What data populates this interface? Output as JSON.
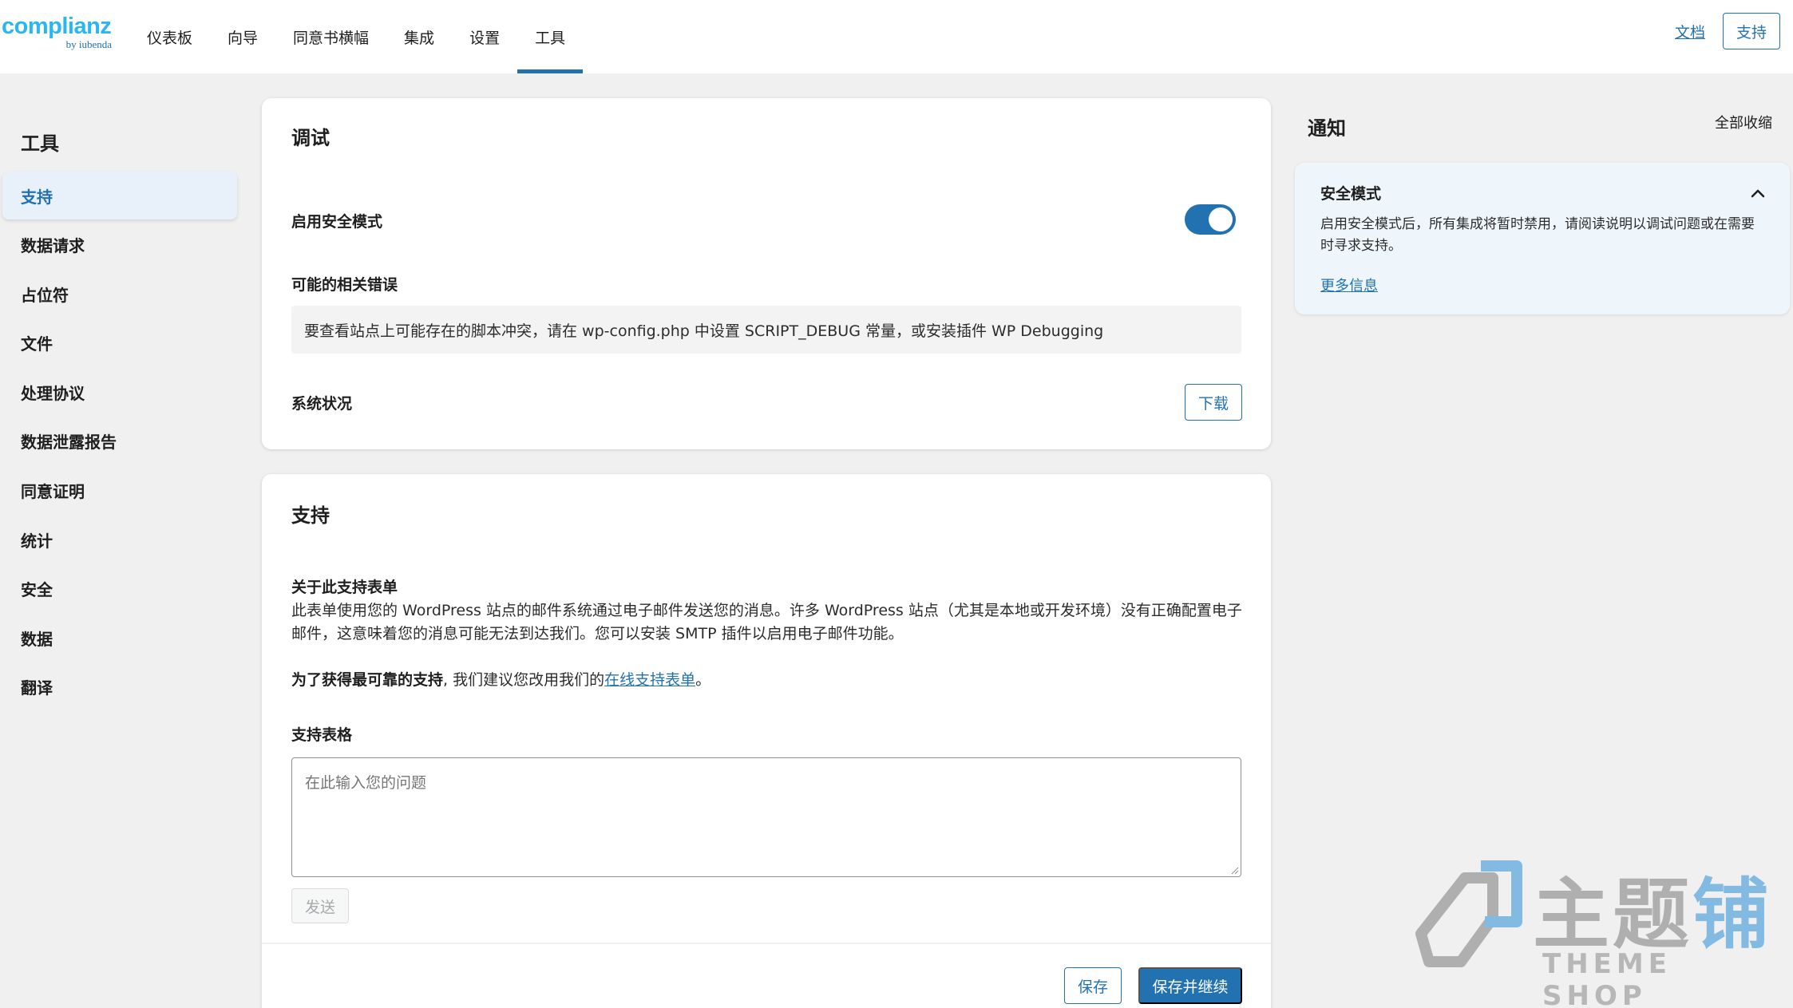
{
  "header": {
    "logo_main": "complianz",
    "logo_sub": "by iubenda",
    "nav": [
      "仪表板",
      "向导",
      "同意书横幅",
      "集成",
      "设置",
      "工具"
    ],
    "active_nav": "工具",
    "docs_label": "文档",
    "support_label": "支持"
  },
  "sidebar": {
    "title": "工具",
    "items": [
      {
        "label": "支持",
        "active": true
      },
      {
        "label": "数据请求"
      },
      {
        "label": "占位符"
      },
      {
        "label": "文件"
      },
      {
        "label": "处理协议"
      },
      {
        "label": "数据泄露报告"
      },
      {
        "label": "同意证明"
      },
      {
        "label": "统计"
      },
      {
        "label": "安全"
      },
      {
        "label": "数据"
      },
      {
        "label": "翻译"
      }
    ]
  },
  "debug_card": {
    "title": "调试",
    "safe_mode_label": "启用安全模式",
    "safe_mode_enabled": true,
    "errors_label": "可能的相关错误",
    "errors_text": "要查看站点上可能存在的脚本冲突，请在 wp-config.php 中设置 SCRIPT_DEBUG 常量，或安装插件 WP Debugging",
    "system_status_label": "系统状况",
    "download_label": "下载"
  },
  "support_card": {
    "title": "支持",
    "about_title": "关于此支持表单",
    "about_text": "此表单使用您的 WordPress 站点的邮件系统通过电子邮件发送您的消息。许多 WordPress 站点（尤其是本地或开发环境）没有正确配置电子邮件，这意味着您的消息可能无法到达我们。您可以安装 SMTP 插件以启用电子邮件功能。",
    "recommend_bold": "为了获得最可靠的支持",
    "recommend_text": ", 我们建议您改用我们的",
    "recommend_link": "在线支持表单",
    "recommend_end": "。",
    "form_label": "支持表格",
    "textarea_placeholder": "在此输入您的问题",
    "send_label": "发送",
    "save_label": "保存",
    "save_continue_label": "保存并继续"
  },
  "notifications": {
    "title": "通知",
    "collapse_all": "全部收缩",
    "items": [
      {
        "title": "安全模式",
        "text": "启用安全模式后，所有集成将暂时禁用，请阅读说明以调试问题或在需要时寻求支持。",
        "link": "更多信息"
      }
    ]
  },
  "watermark": {
    "cn_gray": "主题",
    "cn_blue": "铺",
    "en": "THEME SHOP"
  },
  "colors": {
    "accent": "#2271b1",
    "logo": "#29b6f6",
    "background": "#f0f0f1"
  }
}
